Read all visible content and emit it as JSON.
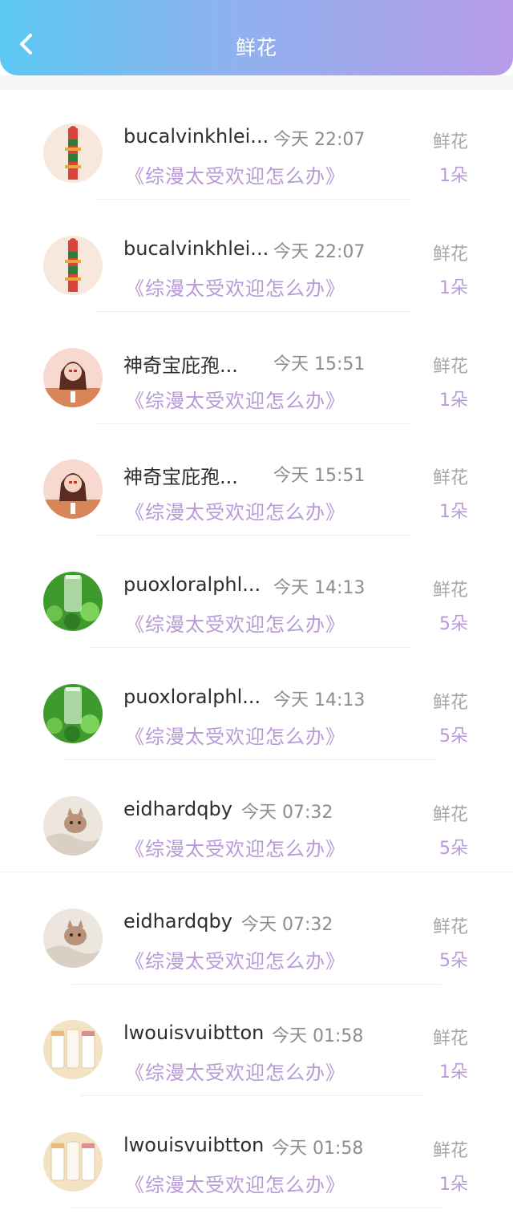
{
  "header": {
    "title": "鲜花"
  },
  "colors": {
    "header_gradient_start": "#5cc8f3",
    "header_gradient_end": "#b79be9",
    "accent": "#b99ad8"
  },
  "items": [
    {
      "name": "bucalvinkhlei...",
      "time": "今天 22:07",
      "book": "《综漫太受欢迎怎么办》",
      "gift": "鲜花",
      "count": "1朵",
      "avatar": "tower-avatar-icon"
    },
    {
      "name": "bucalvinkhlei...",
      "time": "今天 22:07",
      "book": "《综漫太受欢迎怎么办》",
      "gift": "鲜花",
      "count": "1朵",
      "avatar": "tower-avatar-icon"
    },
    {
      "name": "神奇宝庇孢...",
      "time": "今天 15:51",
      "book": "《综漫太受欢迎怎么办》",
      "gift": "鲜花",
      "count": "1朵",
      "avatar": "girl-avatar-icon"
    },
    {
      "name": "神奇宝庇孢...",
      "time": "今天 15:51",
      "book": "《综漫太受欢迎怎么办》",
      "gift": "鲜花",
      "count": "1朵",
      "avatar": "girl-avatar-icon"
    },
    {
      "name": "puoxloralphl...",
      "time": "今天 14:13",
      "book": "《综漫太受欢迎怎么办》",
      "gift": "鲜花",
      "count": "5朵",
      "avatar": "plant-avatar-icon"
    },
    {
      "name": "puoxloralphl...",
      "time": "今天 14:13",
      "book": "《综漫太受欢迎怎么办》",
      "gift": "鲜花",
      "count": "5朵",
      "avatar": "plant-avatar-icon"
    },
    {
      "name": "eidhardqby",
      "time": "今天 07:32",
      "book": "《综漫太受欢迎怎么办》",
      "gift": "鲜花",
      "count": "5朵",
      "avatar": "cat-avatar-icon"
    },
    {
      "name": "eidhardqby",
      "time": "今天 07:32",
      "book": "《综漫太受欢迎怎么办》",
      "gift": "鲜花",
      "count": "5朵",
      "avatar": "cat-avatar-icon"
    },
    {
      "name": "lwouisvuibtton",
      "time": "今天 01:58",
      "book": "《综漫太受欢迎怎么办》",
      "gift": "鲜花",
      "count": "1朵",
      "avatar": "boxes-avatar-icon"
    },
    {
      "name": "lwouisvuibtton",
      "time": "今天 01:58",
      "book": "《综漫太受欢迎怎么办》",
      "gift": "鲜花",
      "count": "1朵",
      "avatar": "boxes-avatar-icon"
    }
  ]
}
